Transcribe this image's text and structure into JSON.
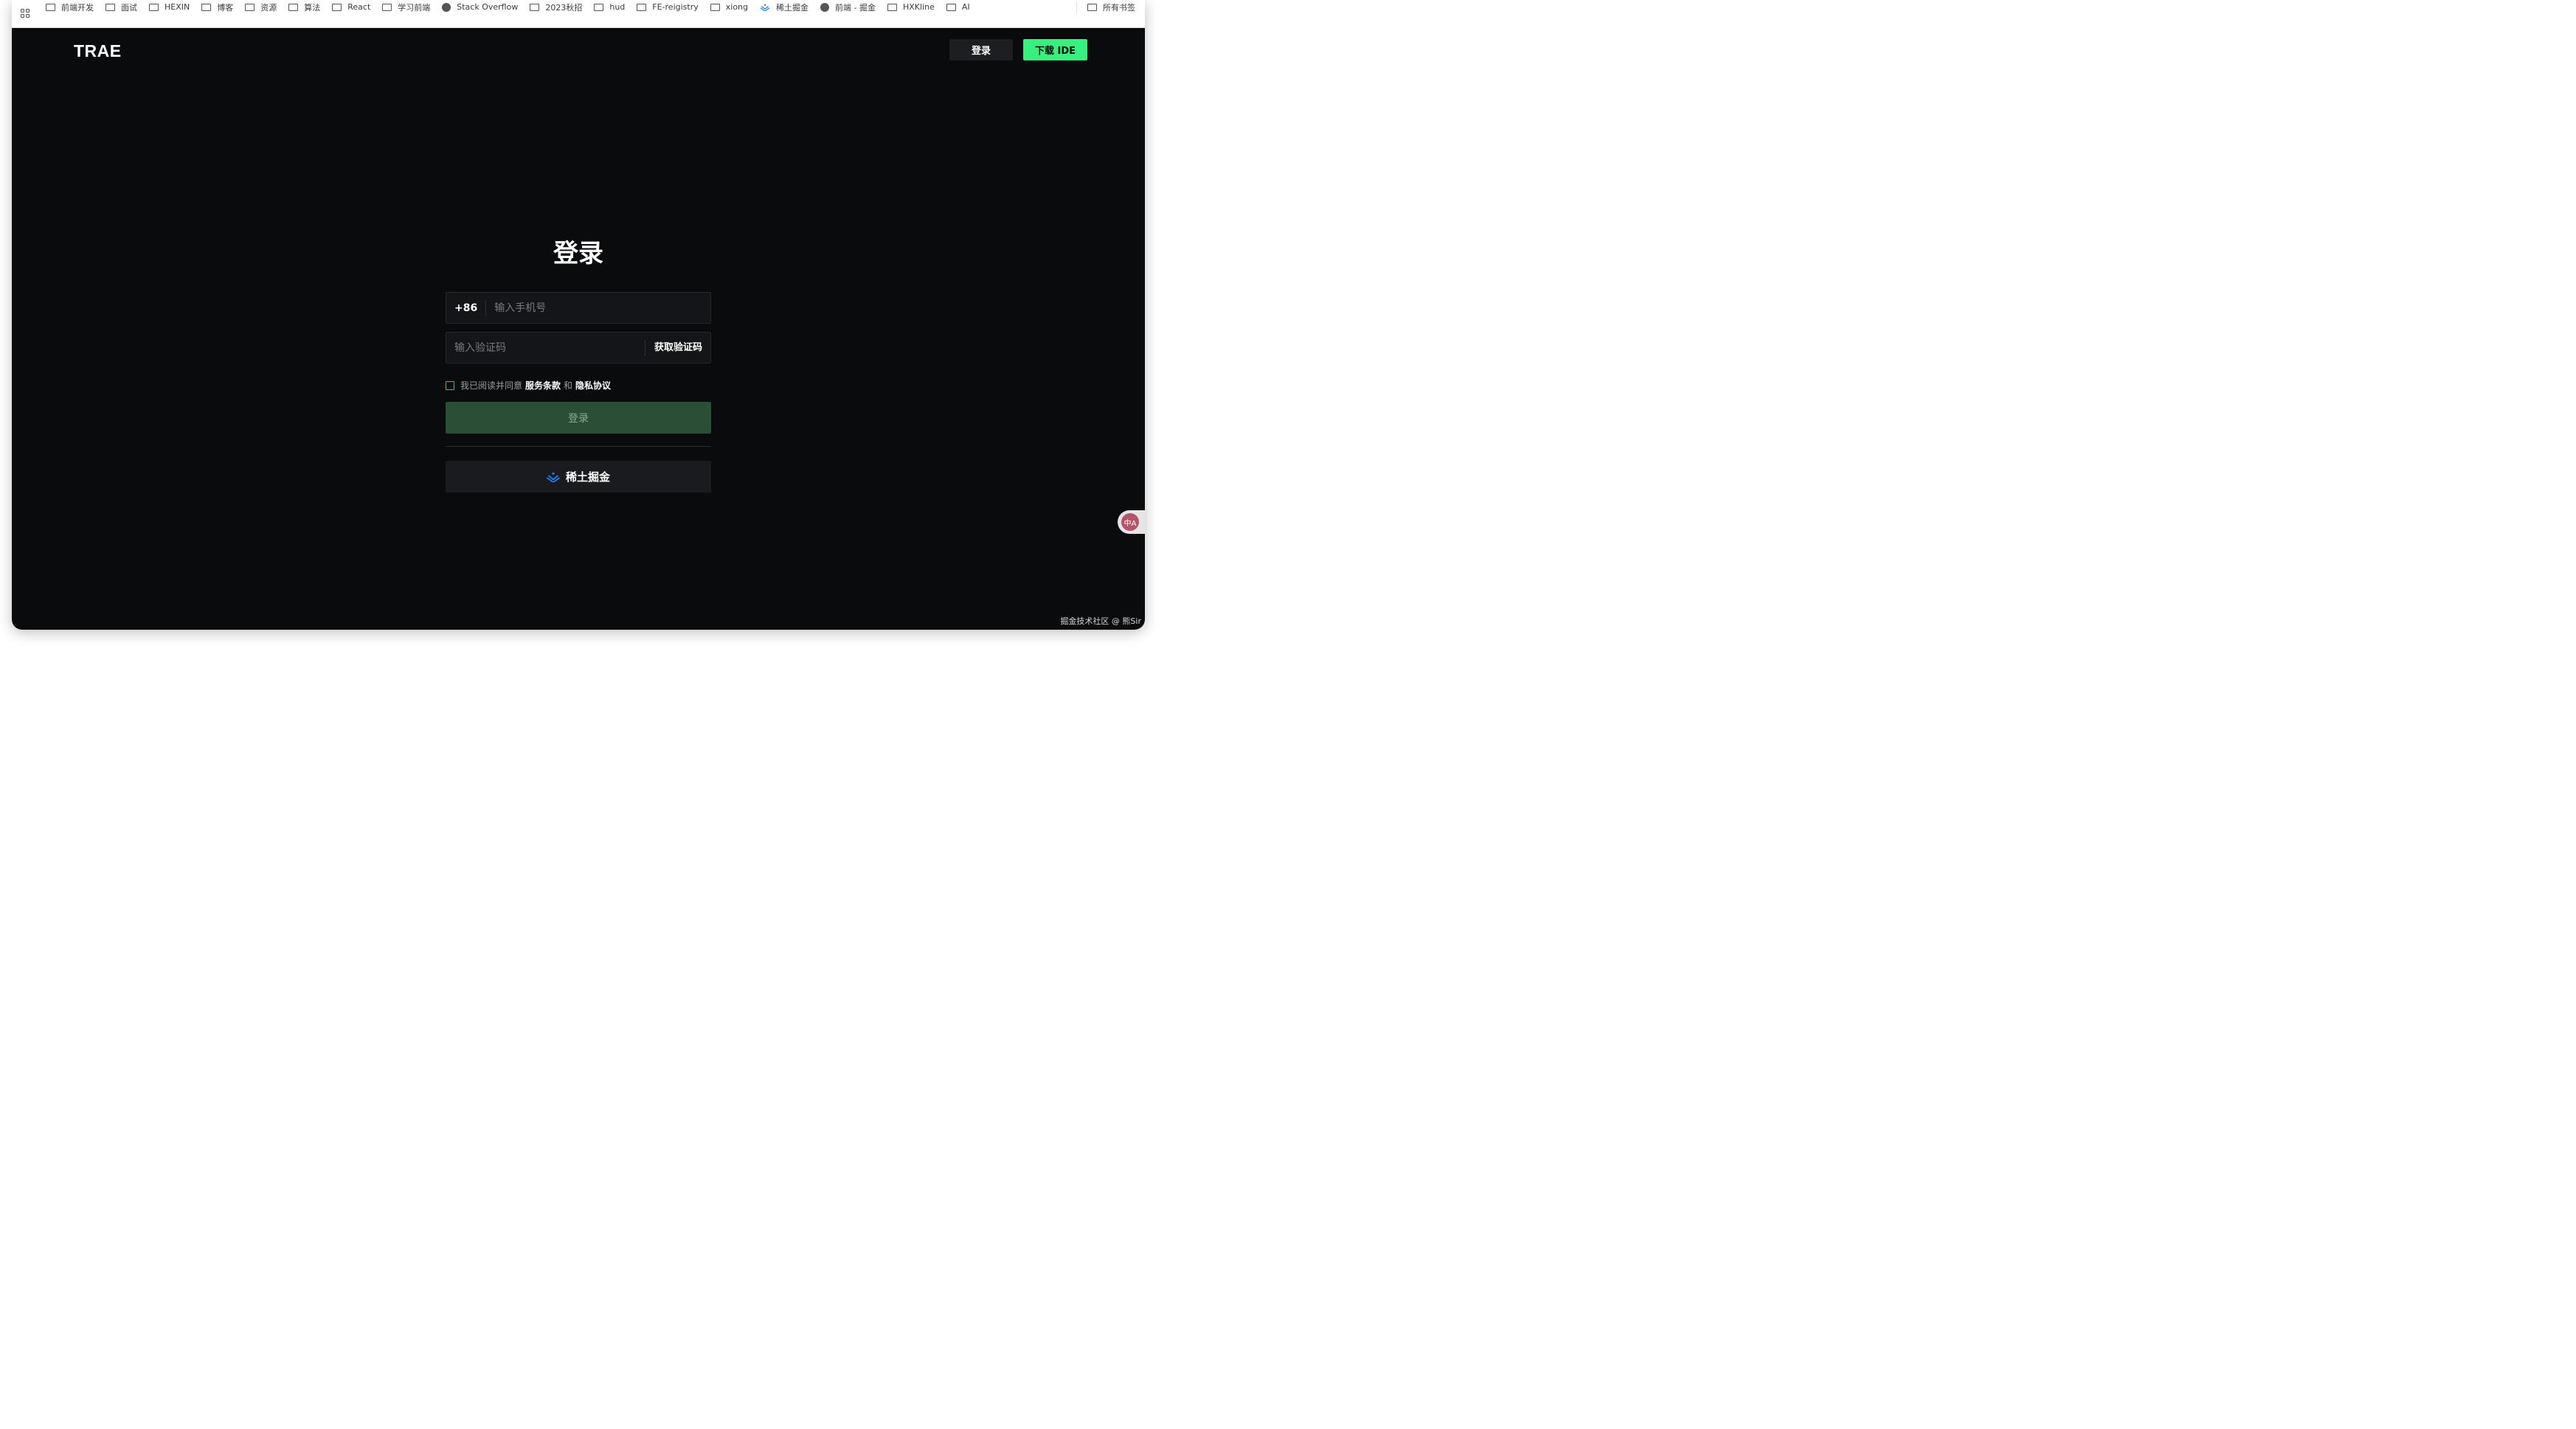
{
  "bookmarks": {
    "items": [
      {
        "label": "前端开发",
        "icon": "folder-icon"
      },
      {
        "label": "面试",
        "icon": "folder-icon"
      },
      {
        "label": "HEXIN",
        "icon": "folder-icon"
      },
      {
        "label": "博客",
        "icon": "folder-icon"
      },
      {
        "label": "资源",
        "icon": "folder-icon"
      },
      {
        "label": "算法",
        "icon": "folder-icon"
      },
      {
        "label": "React",
        "icon": "folder-icon"
      },
      {
        "label": "学习前端",
        "icon": "folder-icon"
      },
      {
        "label": "Stack Overflow",
        "icon": "globe-icon"
      },
      {
        "label": "2023秋招",
        "icon": "folder-icon"
      },
      {
        "label": "hud",
        "icon": "folder-icon"
      },
      {
        "label": "FE-reigistry",
        "icon": "folder-icon"
      },
      {
        "label": "xiong",
        "icon": "folder-icon"
      },
      {
        "label": "稀土掘金",
        "icon": "juejin-icon"
      },
      {
        "label": "前端 - 掘金",
        "icon": "globe-icon"
      },
      {
        "label": "HXKline",
        "icon": "folder-icon"
      },
      {
        "label": "AI",
        "icon": "folder-icon"
      }
    ],
    "all_label": "所有书签"
  },
  "header": {
    "logo": "TRAE",
    "login_label": "登录",
    "download_label": "下载 IDE"
  },
  "login": {
    "title": "登录",
    "country_code": "+86",
    "phone_placeholder": "输入手机号",
    "code_placeholder": "输入验证码",
    "get_code_label": "获取验证码",
    "agree_prefix": "我已阅读并同意",
    "terms_label": "服务条款",
    "and_label": "和",
    "privacy_label": "隐私协议",
    "submit_label": "登录",
    "juejin_label": "稀土掘金"
  },
  "translate": {
    "label": "中A"
  },
  "watermark": "掘金技术社区 @ 熊Sir",
  "colors": {
    "background": "#0a0b0d",
    "accent": "#38f07f",
    "submit_bg": "#2b4f36",
    "juejin_blue": "#1e80ff"
  }
}
